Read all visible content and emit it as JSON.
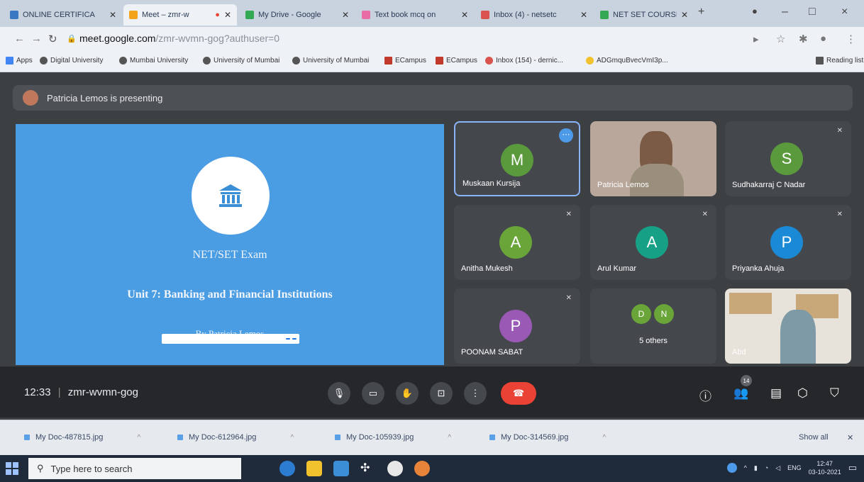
{
  "browser": {
    "tabs": [
      {
        "title": "ONLINE CERTIFICA",
        "favicon_color": "#3b78c4",
        "active": false
      },
      {
        "title": "Meet – zmr-w",
        "favicon_color": "#f2a31a",
        "active": true
      },
      {
        "title": "My Drive - Google",
        "favicon_color": "#34a853",
        "active": false
      },
      {
        "title": "Text book mcq on",
        "favicon_color": "#ea6ca5",
        "active": false
      },
      {
        "title": "Inbox (4) - netsetc",
        "favicon_color": "#d9534f",
        "active": false
      },
      {
        "title": "NET SET COURSE",
        "favicon_color": "#34a853",
        "active": false
      }
    ],
    "new_tab": "+",
    "window_controls": {
      "minimize": "–",
      "maximize": "□",
      "close": "×"
    },
    "url_host": "meet.google.com",
    "url_path": "/zmr-wvmn-gog?authuser=0",
    "bookmarks": [
      "Apps",
      "Digital University",
      "Mumbai University",
      "University of Mumbai",
      "University of Mumbai",
      "ECampus",
      "ECampus",
      "Inbox (154) - dernic...",
      "ADGmquBvecVmI3p...",
      "Reading list"
    ],
    "reading_list": "Reading list"
  },
  "meet": {
    "presenter_banner": "Patricia Lemos is presenting",
    "slide": {
      "title": "NET/SET Exam",
      "unit": "Unit 7: Banking and Financial Institutions",
      "author": "By Patricia Lemos",
      "logo_icon": "bank-icon"
    },
    "participants": [
      {
        "name": "Muskaan Kursija",
        "initial": "M",
        "color": "#5a9a3c",
        "highlight": true
      },
      {
        "name": "Patricia Lemos",
        "initial": "",
        "color": "#b8a79a",
        "video": true
      },
      {
        "name": "Sudhakarraj C Nadar",
        "initial": "S",
        "color": "#5a9a3c"
      },
      {
        "name": "Anitha Mukesh",
        "initial": "A",
        "color": "#6aa53a"
      },
      {
        "name": "Arul Kumar",
        "initial": "A",
        "color": "#16a085"
      },
      {
        "name": "Priyanka Ahuja",
        "initial": "P",
        "color": "#1a8ad6"
      },
      {
        "name": "POONAM SABAT",
        "initial": "P",
        "color": "#9b59b6"
      },
      {
        "name": "5 others",
        "initials": [
          "D",
          "N"
        ],
        "color": "#6aa53a"
      },
      {
        "name": "Abd",
        "initial": "",
        "color": "#7e9aa6",
        "video": true
      }
    ],
    "time": "12:33",
    "meeting_code": "zmr-wvmn-gog",
    "people_count": "14"
  },
  "downloads": {
    "items": [
      "My Doc-487815.jpg",
      "My Doc-612964.jpg",
      "My Doc-105939.jpg",
      "My Doc-314569.jpg"
    ],
    "show_all": "Show all"
  },
  "taskbar": {
    "search_placeholder": "Type here to search",
    "language": "ENG",
    "clock_time": "12:47",
    "clock_date": "03-10-2021"
  }
}
